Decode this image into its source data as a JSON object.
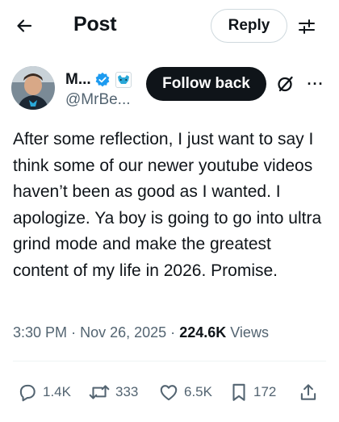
{
  "header": {
    "title": "Post",
    "reply_label": "Reply"
  },
  "author": {
    "display_name": "M...",
    "handle": "@MrBe...",
    "follow_label": "Follow back",
    "more_label": "···"
  },
  "tweet": {
    "text": "After some reflection, I just want to say I think some of our newer youtube videos haven’t been as good as I wanted. I apologize. Ya boy is going to go into ultra grind mode and make the greatest content of my life in 2026. Promise.",
    "time": "3:30 PM",
    "sep1": "·",
    "date": "Nov 26, 2025",
    "sep2": "·",
    "views_count": "224.6K",
    "views_label": "Views"
  },
  "actions": {
    "replies": "1.4K",
    "reposts": "333",
    "likes": "6.5K",
    "bookmarks": "172"
  },
  "colors": {
    "text_primary": "#0f1419",
    "text_secondary": "#536471",
    "verified_blue": "#1d9bf0",
    "border": "#cfd9de"
  },
  "icons": {
    "back": "arrow-left-icon",
    "settings": "sliders-icon",
    "verified": "verified-badge-icon",
    "affiliate": "beast-logo-icon",
    "grok": "grok-icon",
    "reply": "speech-bubble-icon",
    "repost": "repost-icon",
    "like": "heart-icon",
    "bookmark": "bookmark-icon",
    "share": "share-icon"
  }
}
